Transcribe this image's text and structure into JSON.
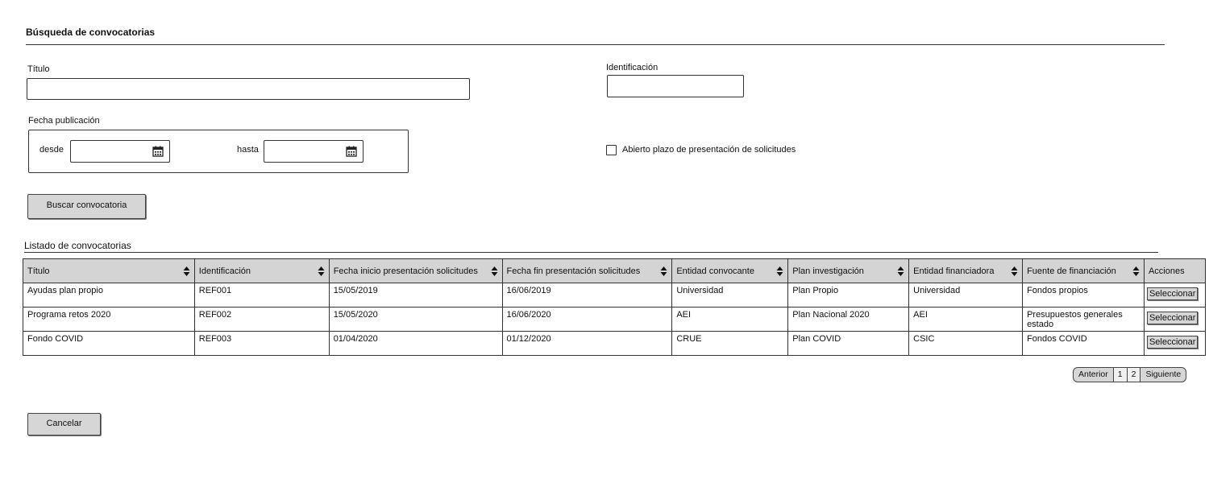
{
  "search": {
    "title": "Búsqueda  de convocatorias",
    "titulo_label": "Título",
    "titulo_value": "",
    "identificacion_label": "Identificación",
    "identificacion_value": "",
    "fecha_label": "Fecha publicación",
    "desde_label": "desde",
    "hasta_label": "hasta",
    "desde_value": "",
    "hasta_value": "",
    "abierto_label": "Abierto plazo de presentación de solicitudes",
    "abierto_checked": false,
    "buscar_label": "Buscar convocatoria"
  },
  "list": {
    "title": "Listado de convocatorias",
    "columns": [
      "Título",
      "Identificación",
      "Fecha inicio presentación solicitudes",
      "Fecha fin presentación solicitudes",
      "Entidad convocante",
      "Plan investigación",
      "Entidad financiadora",
      "Fuente de financiación",
      "Acciones"
    ],
    "rows": [
      [
        "Ayudas plan propio",
        "REF001",
        "15/05/2019",
        "16/06/2019",
        "Universidad",
        "Plan Propio",
        "Universidad",
        "Fondos propios"
      ],
      [
        "Programa retos 2020",
        "REF002",
        "15/05/2020",
        "16/06/2020",
        "AEI",
        "Plan Nacional 2020",
        "AEI",
        "Presupuestos generales estado"
      ],
      [
        "Fondo COVID",
        "REF003",
        "01/04/2020",
        "01/12/2020",
        "CRUE",
        "Plan COVID",
        "CSIC",
        "Fondos COVID"
      ]
    ],
    "row_action_label": "Seleccionar"
  },
  "pager": {
    "prev": "Anterior",
    "pages": [
      "1",
      "2"
    ],
    "next": "Siguiente"
  },
  "cancel_label": "Cancelar"
}
